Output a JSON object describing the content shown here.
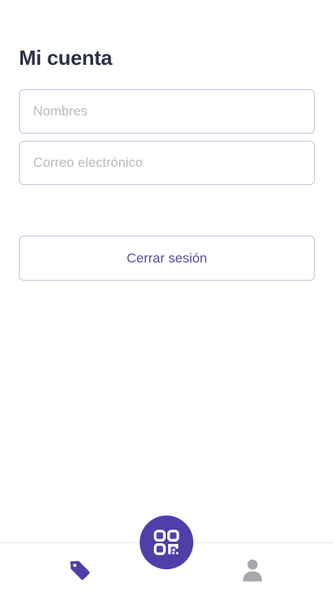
{
  "header": {
    "title": "Mi cuenta"
  },
  "form": {
    "name_placeholder": "Nombres",
    "name_value": "",
    "email_placeholder": "Correo electrónico",
    "email_value": ""
  },
  "actions": {
    "logout_label": "Cerrar sesión"
  },
  "bottom_nav": {
    "items": [
      {
        "icon": "tag-icon",
        "active": true
      },
      {
        "icon": "qr-code-icon",
        "role": "center-action"
      },
      {
        "icon": "user-icon",
        "active": false
      }
    ]
  },
  "colors": {
    "title": "#2d3047",
    "accent": "#4f3fa8",
    "button_text": "#5b4aa6",
    "border": "#c5c2dc",
    "inactive_icon": "#a7a7ad"
  }
}
